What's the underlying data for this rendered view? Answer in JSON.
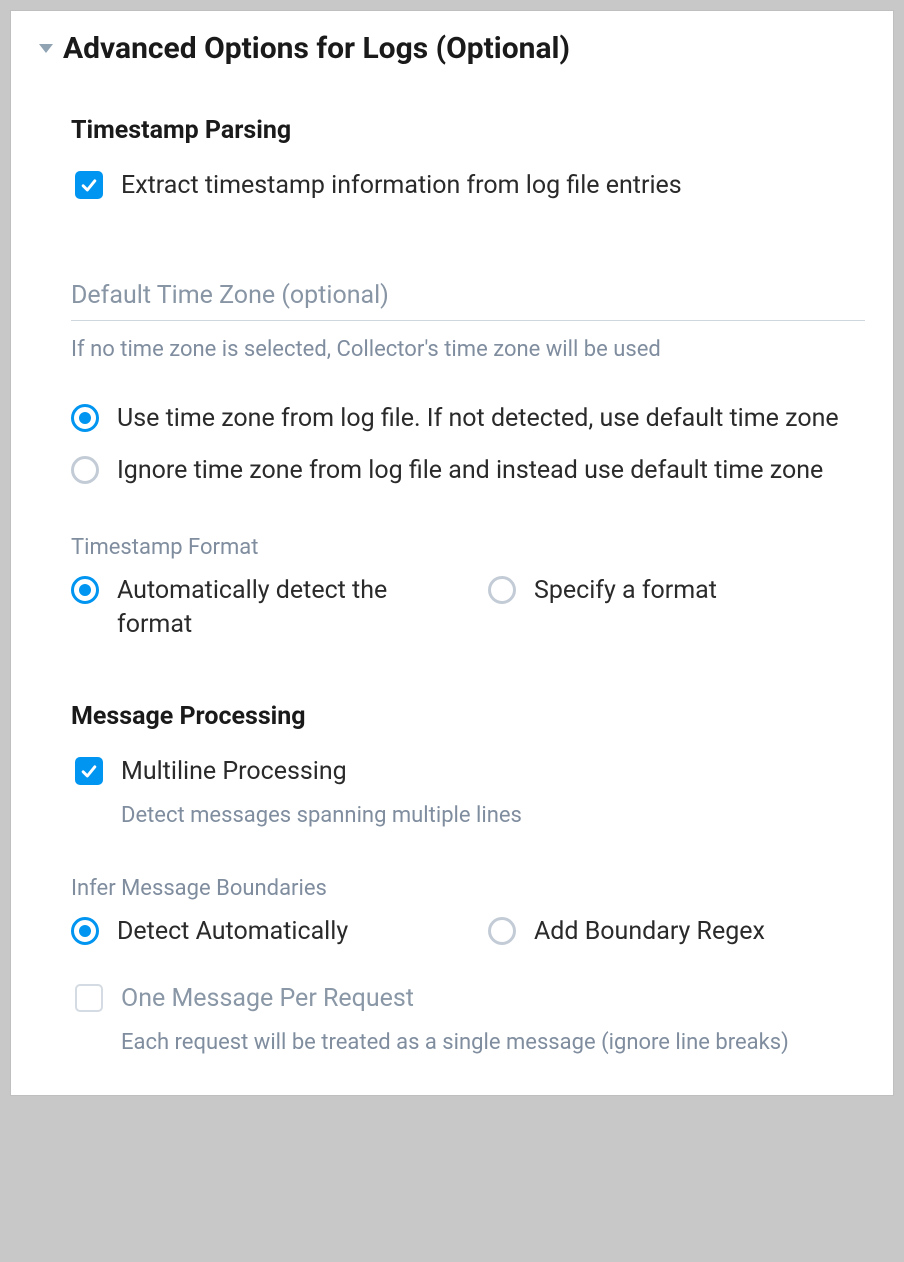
{
  "header": {
    "title": "Advanced Options for Logs (Optional)"
  },
  "timestamp": {
    "heading": "Timestamp Parsing",
    "extract_label": "Extract timestamp information from log file entries",
    "select_placeholder": "Default Time Zone (optional)",
    "select_helper": "If no time zone is selected, Collector's time zone will be used",
    "tz_radio_use": "Use time zone from log file. If not detected, use default time zone",
    "tz_radio_ignore": "Ignore time zone from log file and instead use default time zone",
    "format_label": "Timestamp Format",
    "format_auto": "Automatically detect the format",
    "format_specify": "Specify a format"
  },
  "message": {
    "heading": "Message Processing",
    "multiline_label": "Multiline Processing",
    "multiline_helper": "Detect messages spanning multiple lines",
    "boundaries_label": "Infer Message Boundaries",
    "boundaries_auto": "Detect Automatically",
    "boundaries_regex": "Add Boundary Regex",
    "one_per_request_label": "One Message Per Request",
    "one_per_request_helper": "Each request will be treated as a single message (ignore line breaks)"
  }
}
